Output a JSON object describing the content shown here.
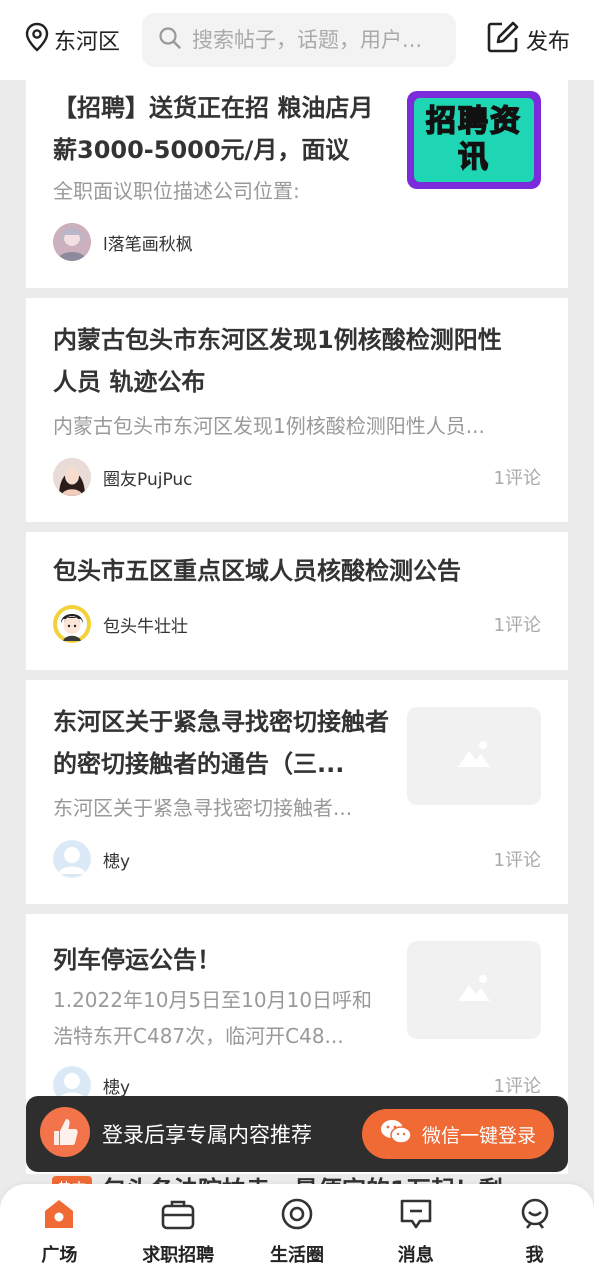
{
  "header": {
    "location": "东河区",
    "search_placeholder": "搜索帖子，话题，用户...",
    "publish_label": "发布"
  },
  "posts": [
    {
      "title": "【招聘】送货正在招 粮油店月薪3000-5000元/月，面议",
      "desc": "全职面议职位描述公司位置:",
      "author": "l落笔画秋枫",
      "thumb_text": "招聘资讯"
    },
    {
      "title": "内蒙古包头市东河区发现1例核酸检测阳性人员 轨迹公布",
      "desc": "内蒙古包头市东河区发现1例核酸检测阳性人员...",
      "author": "圈友PujPuc",
      "comments": "1评论"
    },
    {
      "title": "包头市五区重点区域人员核酸检测公告",
      "author": "包头牛壮壮",
      "comments": "1评论"
    },
    {
      "title": "东河区关于紧急寻找密切接触者的密切接触者的通告（三...",
      "desc": "东河区关于紧急寻找密切接触者...",
      "author": "槵y",
      "comments": "1评论"
    },
    {
      "title": "列车停运公告！",
      "desc": "1.2022年10月5日至10月10日呼和浩特东开C487次，临河开C48...",
      "author": "槵y",
      "comments": "1评论"
    }
  ],
  "peek_post": {
    "badge": "热文",
    "title": "包头各法院拍卖，最便宜的1万起！剩"
  },
  "login_bar": {
    "text": "登录后享专属内容推荐",
    "button": "微信一键登录"
  },
  "tabbar": {
    "items": [
      {
        "label": "广场",
        "active": true
      },
      {
        "label": "求职招聘"
      },
      {
        "label": "生活圈"
      },
      {
        "label": "消息"
      },
      {
        "label": "我"
      }
    ]
  },
  "colors": {
    "accent": "#f06a35",
    "thumb_bg": "#7b2bd9",
    "thumb_inner": "#1fd6b4"
  }
}
